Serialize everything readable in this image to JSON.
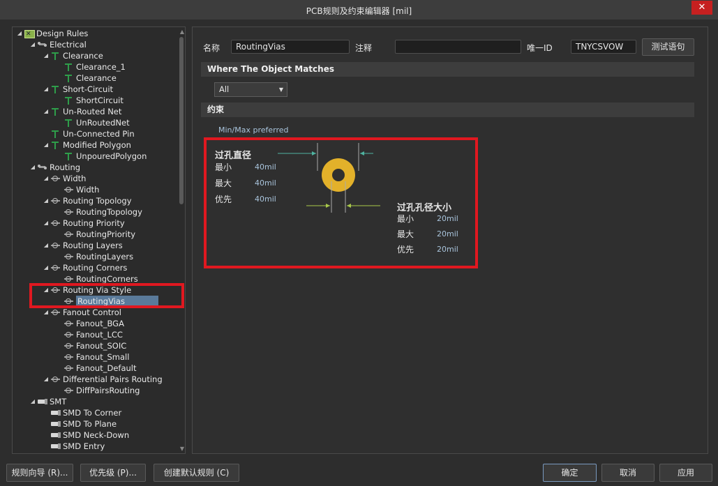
{
  "window": {
    "title": "PCB规则及约束编辑器 [mil]",
    "close_glyph": "✕"
  },
  "tree": [
    {
      "label": "Design Rules",
      "level": 0,
      "icon": "root-icon",
      "expanded": true
    },
    {
      "label": "Electrical",
      "level": 1,
      "icon": "group-icon",
      "expanded": true
    },
    {
      "label": "Clearance",
      "level": 2,
      "icon": "rule-icon",
      "expanded": true
    },
    {
      "label": "Clearance_1",
      "level": 3,
      "icon": "rule-icon"
    },
    {
      "label": "Clearance",
      "level": 3,
      "icon": "rule-icon"
    },
    {
      "label": "Short-Circuit",
      "level": 2,
      "icon": "rule-icon",
      "expanded": true
    },
    {
      "label": "ShortCircuit",
      "level": 3,
      "icon": "rule-icon"
    },
    {
      "label": "Un-Routed Net",
      "level": 2,
      "icon": "rule-icon",
      "expanded": true
    },
    {
      "label": "UnRoutedNet",
      "level": 3,
      "icon": "rule-icon"
    },
    {
      "label": "Un-Connected Pin",
      "level": 2,
      "icon": "rule-icon"
    },
    {
      "label": "Modified Polygon",
      "level": 2,
      "icon": "rule-icon",
      "expanded": true
    },
    {
      "label": "UnpouredPolygon",
      "level": 3,
      "icon": "rule-icon"
    },
    {
      "label": "Routing",
      "level": 1,
      "icon": "group-icon",
      "expanded": true
    },
    {
      "label": "Width",
      "level": 2,
      "icon": "routing-icon",
      "expanded": true
    },
    {
      "label": "Width",
      "level": 3,
      "icon": "routing-icon"
    },
    {
      "label": "Routing Topology",
      "level": 2,
      "icon": "routing-icon",
      "expanded": true
    },
    {
      "label": "RoutingTopology",
      "level": 3,
      "icon": "routing-icon"
    },
    {
      "label": "Routing Priority",
      "level": 2,
      "icon": "routing-icon",
      "expanded": true
    },
    {
      "label": "RoutingPriority",
      "level": 3,
      "icon": "routing-icon"
    },
    {
      "label": "Routing Layers",
      "level": 2,
      "icon": "routing-icon",
      "expanded": true
    },
    {
      "label": "RoutingLayers",
      "level": 3,
      "icon": "routing-icon"
    },
    {
      "label": "Routing Corners",
      "level": 2,
      "icon": "routing-icon",
      "expanded": true
    },
    {
      "label": "RoutingCorners",
      "level": 3,
      "icon": "routing-icon"
    },
    {
      "label": "Routing Via Style",
      "level": 2,
      "icon": "routing-icon",
      "expanded": true
    },
    {
      "label": "RoutingVias",
      "level": 3,
      "icon": "routing-icon",
      "selected": true
    },
    {
      "label": "Fanout Control",
      "level": 2,
      "icon": "routing-icon",
      "expanded": true
    },
    {
      "label": "Fanout_BGA",
      "level": 3,
      "icon": "routing-icon"
    },
    {
      "label": "Fanout_LCC",
      "level": 3,
      "icon": "routing-icon"
    },
    {
      "label": "Fanout_SOIC",
      "level": 3,
      "icon": "routing-icon"
    },
    {
      "label": "Fanout_Small",
      "level": 3,
      "icon": "routing-icon"
    },
    {
      "label": "Fanout_Default",
      "level": 3,
      "icon": "routing-icon"
    },
    {
      "label": "Differential Pairs Routing",
      "level": 2,
      "icon": "routing-icon",
      "expanded": true
    },
    {
      "label": "DiffPairsRouting",
      "level": 3,
      "icon": "routing-icon"
    },
    {
      "label": "SMT",
      "level": 1,
      "icon": "smd-icon",
      "expanded": true
    },
    {
      "label": "SMD To Corner",
      "level": 2,
      "icon": "smd-icon"
    },
    {
      "label": "SMD To Plane",
      "level": 2,
      "icon": "smd-icon"
    },
    {
      "label": "SMD Neck-Down",
      "level": 2,
      "icon": "smd-icon"
    },
    {
      "label": "SMD Entry",
      "level": 2,
      "icon": "smd-icon"
    }
  ],
  "rule": {
    "name_label": "名称",
    "name_value": "RoutingVias",
    "comment_label": "注释",
    "comment_value": "",
    "uid_label": "唯一ID",
    "uid_value": "TNYCSVOW",
    "test_button": "测试语句"
  },
  "where": {
    "header": "Where The Object Matches",
    "selected": "All"
  },
  "constraints": {
    "header": "约束",
    "hint": "Min/Max preferred",
    "via_diameter": {
      "title": "过孔直径",
      "rows": [
        {
          "label": "最小",
          "value": "40mil"
        },
        {
          "label": "最大",
          "value": "40mil"
        },
        {
          "label": "优先",
          "value": "40mil"
        }
      ]
    },
    "hole_size": {
      "title": "过孔孔径大小",
      "rows": [
        {
          "label": "最小",
          "value": "20mil"
        },
        {
          "label": "最大",
          "value": "20mil"
        },
        {
          "label": "优先",
          "value": "20mil"
        }
      ]
    },
    "via_color": "#e3b12a"
  },
  "footer": {
    "rule_wizard": "规则向导 (R)...",
    "priority": "优先级 (P)...",
    "create_default": "创建默认规则 (C)",
    "ok": "确定",
    "cancel": "取消",
    "apply": "应用"
  },
  "highlight_color": "#e01820"
}
